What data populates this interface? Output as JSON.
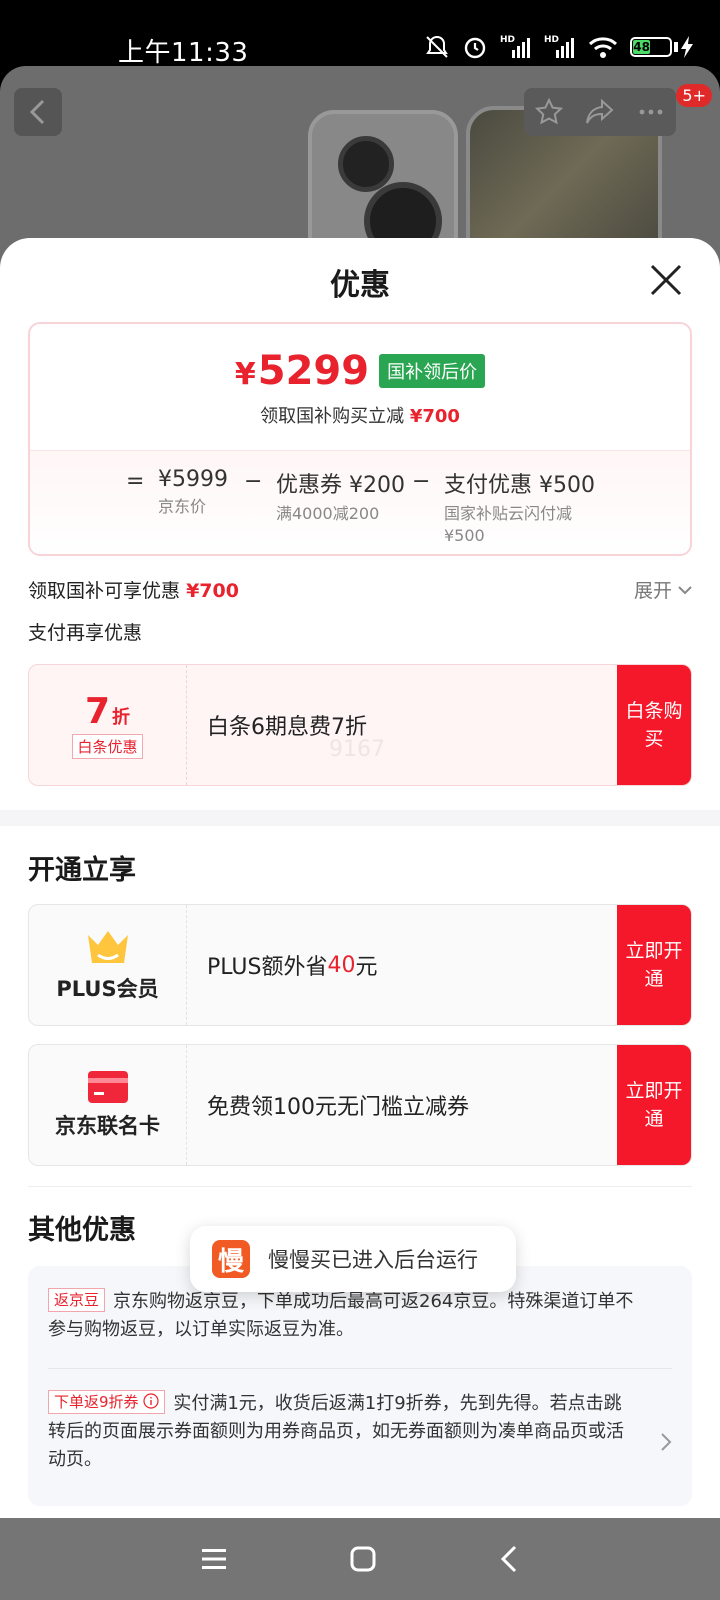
{
  "status_bar": {
    "time": "上午11:33",
    "battery": "48",
    "sig1": "HD",
    "sig2": "HD"
  },
  "product": {
    "badge": "5+"
  },
  "sheet": {
    "title": "优惠",
    "price": {
      "currency": "¥",
      "final": "5299",
      "tag": "国补领后价",
      "sub_prefix": "领取国补购买立减",
      "sub_amount": "¥700",
      "eq": "=",
      "minus": "−",
      "items": [
        {
          "value": "¥5999",
          "desc": "京东价"
        },
        {
          "value": "优惠券 ¥200",
          "desc": "满4000减200"
        },
        {
          "value": "支付优惠 ¥500",
          "desc": "国家补贴云闪付减¥500"
        }
      ]
    },
    "guobu_row": {
      "label": "领取国补可享优惠",
      "amount": "¥700",
      "expand": "展开"
    },
    "pay_more": "支付再享优惠",
    "baitiao": {
      "discount": "7",
      "unit": "折",
      "tag": "白条优惠",
      "text": "白条6期息费7折",
      "watermark": "9167",
      "button": "白条购买"
    },
    "open_section": {
      "title": "开通立享"
    },
    "plus": {
      "label": "PLUS会员",
      "text_prefix": "PLUS额外省",
      "amount": "40",
      "text_suffix": "元",
      "button": "立即开通"
    },
    "card": {
      "label": "京东联名卡",
      "text": "免费领100元无门槛立减券",
      "button": "立即开通"
    },
    "other_section": {
      "title": "其他优惠"
    },
    "other": [
      {
        "tag": "返京豆",
        "text": "京东购物返京豆，下单成功后最高可返264京豆。特殊渠道订单不参与购物返豆，以订单实际返豆为准。"
      },
      {
        "tag": "下单返9折券",
        "text": "实付满1元，收货后返满1打9折券，先到先得。若点击跳转后的页面展示券面额则为用券商品页，如无券面额则为凑单商品页或活动页。"
      }
    ]
  },
  "toast": {
    "icon_text": "慢",
    "text": "慢慢买已进入后台运行"
  },
  "colors": {
    "accent": "#f5172a",
    "price_red": "#e8232e",
    "tag_green": "#2aa652"
  }
}
